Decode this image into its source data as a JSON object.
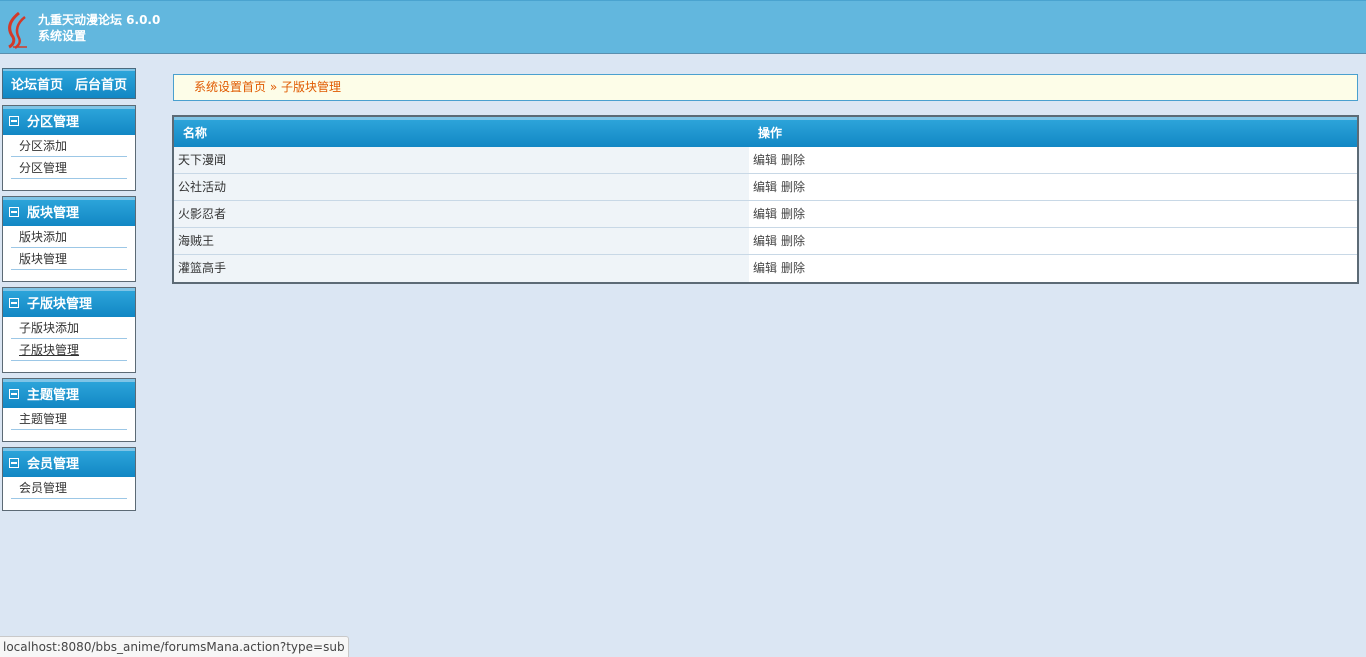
{
  "header": {
    "title": "九重天动漫论坛 6.0.0",
    "subtitle": "系统设置"
  },
  "sidebar": {
    "top_links": [
      "论坛首页",
      "后台首页"
    ],
    "menus": [
      {
        "title": "分区管理",
        "items": [
          "分区添加",
          "分区管理"
        ]
      },
      {
        "title": "版块管理",
        "items": [
          "版块添加",
          "版块管理"
        ]
      },
      {
        "title": "子版块管理",
        "items": [
          "子版块添加",
          "子版块管理"
        ]
      },
      {
        "title": "主题管理",
        "items": [
          "主题管理"
        ]
      },
      {
        "title": "会员管理",
        "items": [
          "会员管理"
        ]
      }
    ]
  },
  "breadcrumb": {
    "home": "系统设置首页",
    "separator": "»",
    "current": "子版块管理"
  },
  "table": {
    "headers": [
      "名称",
      "操作"
    ],
    "rows": [
      {
        "name": "天下漫闻",
        "edit": "编辑",
        "delete": "删除"
      },
      {
        "name": "公社活动",
        "edit": "编辑",
        "delete": "删除"
      },
      {
        "name": "火影忍者",
        "edit": "编辑",
        "delete": "删除"
      },
      {
        "name": "海贼王",
        "edit": "编辑",
        "delete": "删除"
      },
      {
        "name": "灌篮高手",
        "edit": "编辑",
        "delete": "删除"
      }
    ]
  },
  "statusbar": {
    "url": "localhost:8080/bbs_anime/forumsMana.action?type=sub"
  },
  "colors": {
    "header_bg": "#62b7de",
    "page_bg": "#dbe6f3",
    "menu_head": "#1287c4",
    "breadcrumb_text": "#e05a00"
  }
}
